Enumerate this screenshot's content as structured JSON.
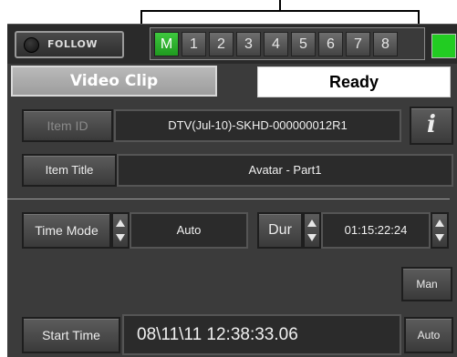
{
  "follow": {
    "label": "FOLLOW"
  },
  "channels": [
    {
      "label": "M",
      "active": true
    },
    {
      "label": "1",
      "active": false
    },
    {
      "label": "2",
      "active": false
    },
    {
      "label": "3",
      "active": false
    },
    {
      "label": "4",
      "active": false
    },
    {
      "label": "5",
      "active": false
    },
    {
      "label": "6",
      "active": false
    },
    {
      "label": "7",
      "active": false
    },
    {
      "label": "8",
      "active": false
    }
  ],
  "colors": {
    "accent_green": "#22cc22",
    "panel_bg": "#3b3b3b",
    "active_channel": "#2fb52f"
  },
  "clip": {
    "mode_label": "Video Clip",
    "status": "Ready"
  },
  "item_id": {
    "label": "Item ID",
    "value": "DTV(Jul-10)-SKHD-000000012R1",
    "info_icon": "i"
  },
  "item_title": {
    "label": "Item Title",
    "value": "Avatar - Part1"
  },
  "time_mode": {
    "label": "Time Mode",
    "value": "Auto"
  },
  "duration": {
    "label": "Dur",
    "value": "01:15:22:24"
  },
  "man": {
    "label": "Man"
  },
  "start_time": {
    "label": "Start Time",
    "value": "08\\11\\11 12:38:33.06",
    "auto_label": "Auto"
  }
}
